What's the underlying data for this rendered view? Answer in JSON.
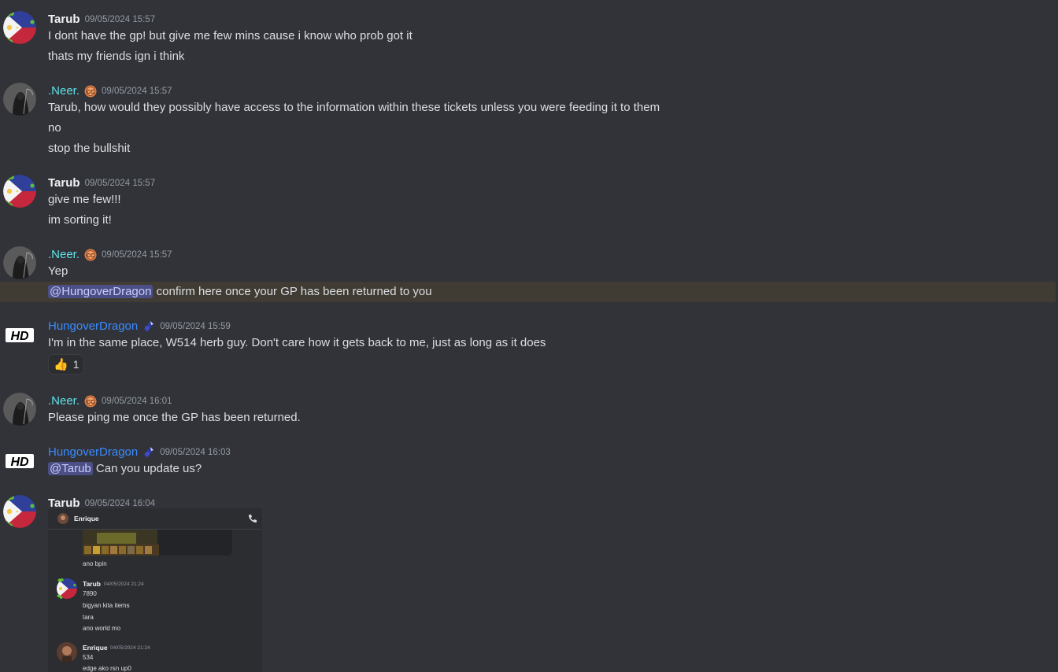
{
  "messages": [
    {
      "author": "Tarub",
      "timestamp": "09/05/2024 15:57",
      "lines": [
        "I dont have the gp! but give me few mins cause i know who prob got it",
        "thats my friends ign i think"
      ]
    },
    {
      "author": ".Neer.",
      "timestamp": "09/05/2024 15:57",
      "lines": [
        "Tarub, how would they possibly have access to the information within these tickets unless you were feeding it to them",
        "no",
        "stop the bullshit"
      ]
    },
    {
      "author": "Tarub",
      "timestamp": "09/05/2024 15:57",
      "lines": [
        "give me few!!!",
        "im sorting it!"
      ]
    },
    {
      "author": ".Neer.",
      "timestamp": "09/05/2024 15:57",
      "lines": [
        "Yep"
      ],
      "mention": "@HungoverDragon",
      "mention_text": " confirm here once your GP has been returned to you"
    },
    {
      "author": "HungoverDragon",
      "timestamp": "09/05/2024 15:59",
      "lines": [
        "I'm in the same place, W514 herb guy.  Don't care how it gets back to me, just as long as it does"
      ],
      "reaction": {
        "emoji": "👍",
        "count": "1"
      }
    },
    {
      "author": ".Neer.",
      "timestamp": "09/05/2024 16:01",
      "lines": [
        "Please ping me once the GP has been returned."
      ]
    },
    {
      "author": "HungoverDragon",
      "timestamp": "09/05/2024 16:03",
      "mention": "@Tarub",
      "mention_text": " Can you update us?"
    },
    {
      "author": "Tarub",
      "timestamp": "09/05/2024 16:04"
    }
  ],
  "attachment": {
    "header_name": "Enrique",
    "first_msg": "ano bpin",
    "msg2": {
      "author": "Tarub",
      "timestamp": "04/05/2024 21:24",
      "lines": [
        "7890",
        "bigyan kita items",
        "tara",
        "ano world mo"
      ]
    },
    "msg3": {
      "author": "Enrique",
      "timestamp": "04/05/2024 21:24",
      "lines": [
        "534",
        "edge ako rsn up0"
      ]
    }
  },
  "colors": {
    "background": "#313338",
    "neer": "#5ee3e8",
    "hungoverdragon": "#3a8bff",
    "mention_bg": "#4b4f86",
    "highlight": "#403c34"
  }
}
